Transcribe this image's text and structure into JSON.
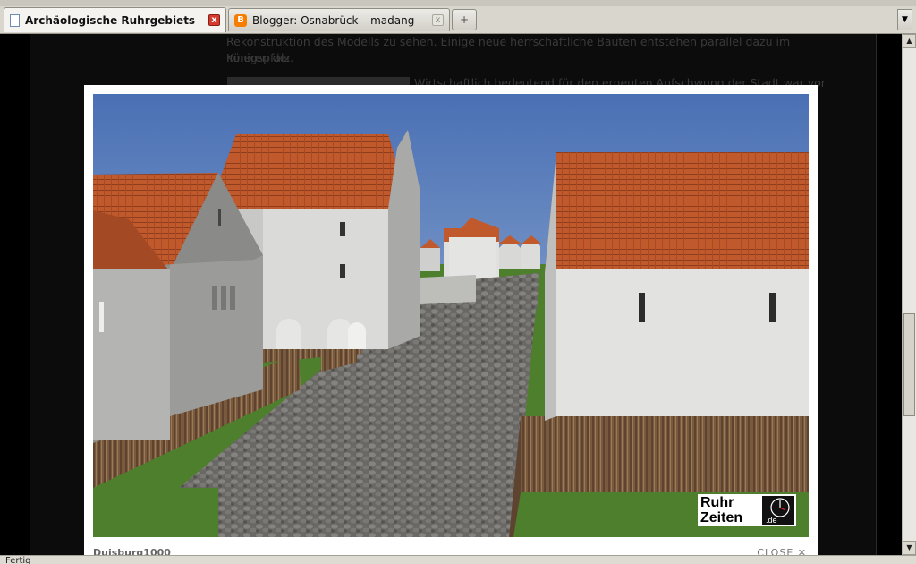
{
  "browser": {
    "tabs": [
      {
        "label": "Archäologische Ruhrgebiets",
        "close": "x",
        "active": true
      },
      {
        "label": "Blogger: Osnabrück – madang – …",
        "close": "x",
        "active": false
      }
    ],
    "new_tab_label": "+",
    "tab_list_glyph": "▼",
    "status_text": "Fertig"
  },
  "page": {
    "text_line_1": "Rekonstruktion des Modells zu sehen. Einige neue herrschaftliche Bauten entstehen parallel dazu im Inneren der",
    "text_line_2": "Königspfalz.",
    "text_line_3": "Wirtschaftlich bedeutend für den erneuten Aufschwung der Stadt war vor"
  },
  "lightbox": {
    "caption": "Duisburg1000",
    "close_label": "CLOSE ✕",
    "logo_line_1": "Ruhr",
    "logo_line_2": "Zeiten",
    "logo_badge": ".de"
  },
  "colors": {
    "sky_top": "#4a74b8",
    "roof": "#c05a2c",
    "wall": "#d2d2d0",
    "cobble": "#6a6865",
    "grass": "#4d7f2c",
    "fence": "#7a5a3c"
  }
}
